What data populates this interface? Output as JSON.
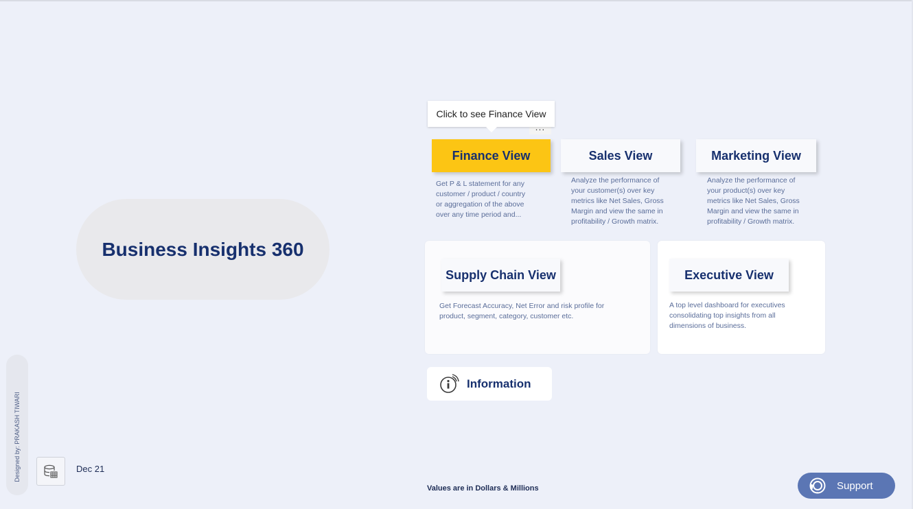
{
  "hero": {
    "title": "Business Insights 360"
  },
  "tooltip": {
    "text": "Click to see Finance View",
    "more": "..."
  },
  "nav": {
    "finance": {
      "label": "Finance View",
      "desc": [
        "Get P & L statement for any",
        "customer / product / country",
        "or aggregation of the above",
        "over any time period and..."
      ]
    },
    "sales": {
      "label": "Sales View",
      "desc": [
        "Analyze the performance of",
        "your customer(s) over key",
        "metrics like Net Sales, Gross",
        "Margin and view the same in",
        "profitability / Growth matrix."
      ]
    },
    "marketing": {
      "label": "Marketing View",
      "desc": [
        "Analyze the performance of",
        "your product(s) over key",
        "metrics like Net Sales, Gross",
        "Margin and view the same in",
        "profitability / Growth matrix."
      ]
    },
    "supply_chain": {
      "label": "Supply Chain View",
      "desc": [
        "Get Forecast Accuracy, Net Error and risk profile for",
        "product, segment, category, customer etc."
      ]
    },
    "executive": {
      "label": "Executive View",
      "desc": [
        "A top level dashboard for executives",
        "consolidating top insights from all",
        "dimensions of business."
      ]
    }
  },
  "information": {
    "label": "Information",
    "icon": "info-touch-icon"
  },
  "footer": {
    "designer": "Designed by: PRAKASH TIWARI",
    "date": "Dec 21",
    "note": "Values are in Dollars & Millions",
    "refresh_icon": "database-table-icon"
  },
  "support": {
    "label": "Support",
    "icon": "headset-icon"
  },
  "colors": {
    "accent": "#fcc514",
    "navy": "#17306e",
    "background": "#edf0f9",
    "support": "#5b76b4"
  }
}
